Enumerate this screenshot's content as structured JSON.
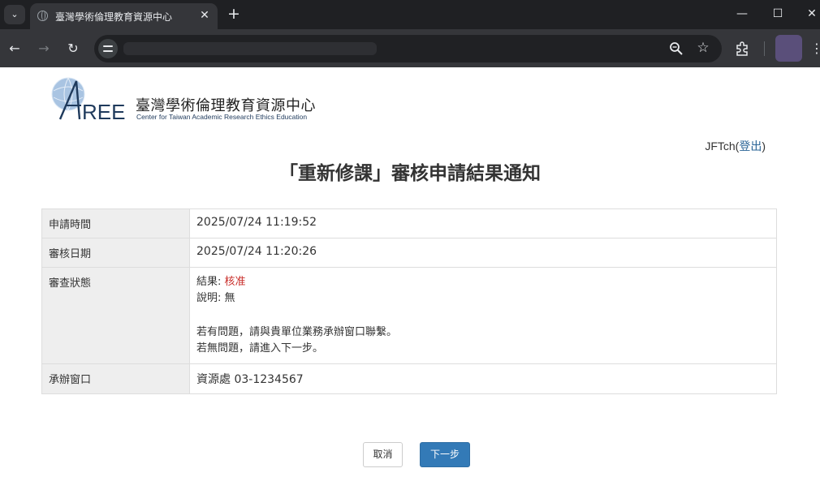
{
  "browser": {
    "tab_title": "臺灣學術倫理教育資源中心",
    "tab_close": "✕",
    "new_tab": "+",
    "window": {
      "minimize": "—",
      "maximize": "☐",
      "close": "✕"
    }
  },
  "header": {
    "logo_cn": "臺灣學術倫理教育資源中心",
    "logo_en": "Center for Taiwan Academic Research Ethics Education",
    "logo_mark": "AREE"
  },
  "user": {
    "name": "JFTch",
    "open_paren": "(",
    "logout": "登出",
    "close_paren": ")"
  },
  "page_title": "「重新修課」審核申請結果通知",
  "table": {
    "rows": [
      {
        "label": "申請時間",
        "value": "2025/07/24 11:19:52"
      },
      {
        "label": "審核日期",
        "value": "2025/07/24 11:20:26"
      },
      {
        "label": "審查狀態",
        "result_label": "結果: ",
        "result_value": "核准",
        "note_label": "說明: ",
        "note_value": "無",
        "line1": "若有問題，請與貴單位業務承辦窗口聯繫。",
        "line2": "若無問題，請進入下一步。"
      },
      {
        "label": "承辦窗口",
        "value": "資源處 03-1234567"
      }
    ]
  },
  "buttons": {
    "cancel": "取消",
    "next": "下一步"
  },
  "colors": {
    "primary": "#337ab7",
    "approved": "#c9302c",
    "label_bg": "#eeeeee"
  }
}
